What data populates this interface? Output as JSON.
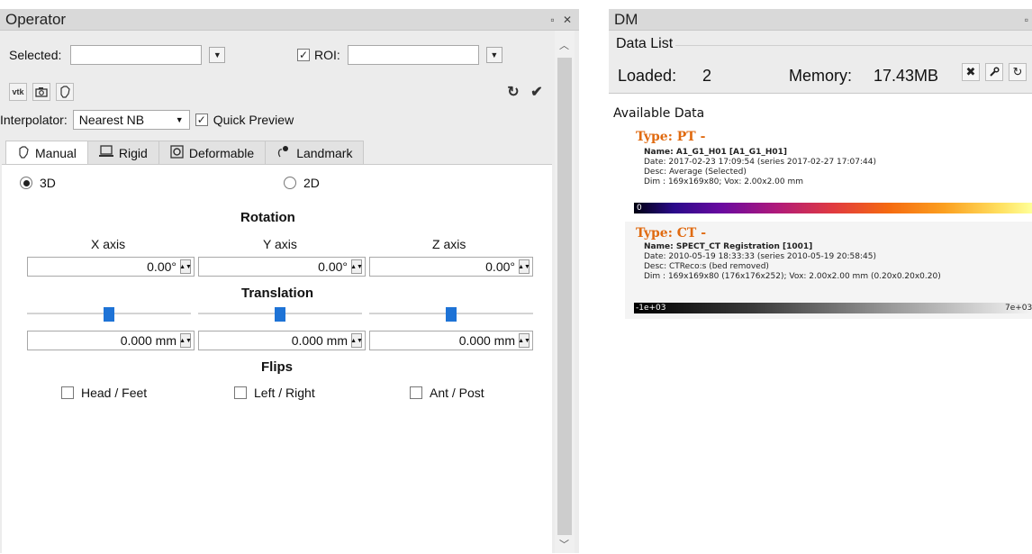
{
  "operator": {
    "title": "Operator",
    "float_glyph": "ฃ",
    "close_glyph": "✕",
    "selected_label": "Selected:",
    "selected_value": "",
    "roi_label": "ROI:",
    "roi_checked": true,
    "roi_value": "",
    "tool_buttons": [
      "vtk",
      "camera",
      "hand"
    ],
    "interpolator_label": "Interpolator:",
    "interpolator_value": "Nearest NB",
    "quick_preview_label": "Quick Preview",
    "quick_preview_checked": true,
    "tabs": [
      {
        "label": "Manual",
        "icon": "hand-icon",
        "active": true
      },
      {
        "label": "Rigid",
        "icon": "monitor-icon",
        "active": false
      },
      {
        "label": "Deformable",
        "icon": "deform-icon",
        "active": false
      },
      {
        "label": "Landmark",
        "icon": "landmark-icon",
        "active": false
      }
    ],
    "mode_3d": "3D",
    "mode_2d": "2D",
    "mode_selected": "3D",
    "rotation_title": "Rotation",
    "axis_labels": [
      "X axis",
      "Y axis",
      "Z axis"
    ],
    "rotation_values": [
      "0.00°",
      "0.00°",
      "0.00°"
    ],
    "translation_title": "Translation",
    "translation_values": [
      "0.000 mm",
      "0.000 mm",
      "0.000 mm"
    ],
    "translation_slider_levels": [
      0.5,
      0.5,
      0.5
    ],
    "flips_title": "Flips",
    "flips": [
      "Head / Feet",
      "Left / Right",
      "Ant / Post"
    ]
  },
  "dm": {
    "title": "DM",
    "float_glyph": "ฃ",
    "group_title": "Data List",
    "loaded_label": "Loaded:",
    "loaded_value": "2",
    "memory_label": "Memory:",
    "memory_value": "17.43MB",
    "available_label": "Available Data",
    "datasets": [
      {
        "type_label": "Type: PT -",
        "name": "Name: A1_G1_H01 [A1_G1_H01]",
        "date": "Date: 2017-02-23 17:09:54 (series 2017-02-27 17:07:44)",
        "desc": "Desc: Average (Selected)",
        "dim": "Dim : 169x169x80; Vox: 2.00x2.00 mm",
        "cbar_min": "0",
        "cbar_max": ""
      },
      {
        "type_label": "Type: CT -",
        "name": "Name: SPECT_CT Registration [1001]",
        "date": "Date: 2010-05-19 18:33:33 (series 2010-05-19 20:58:45)",
        "desc": "Desc: CTReco:s (bed removed)",
        "dim": "Dim : 169x169x80 (176x176x252); Vox: 2.00x2.00 mm (0.20x0.20x0.20)",
        "cbar_min": "-1e+03",
        "cbar_max": "7e+03"
      }
    ]
  },
  "colors": {
    "type_label": "#e06a10",
    "slider_handle": "#1e73d6",
    "panel_bg": "#ececec"
  }
}
